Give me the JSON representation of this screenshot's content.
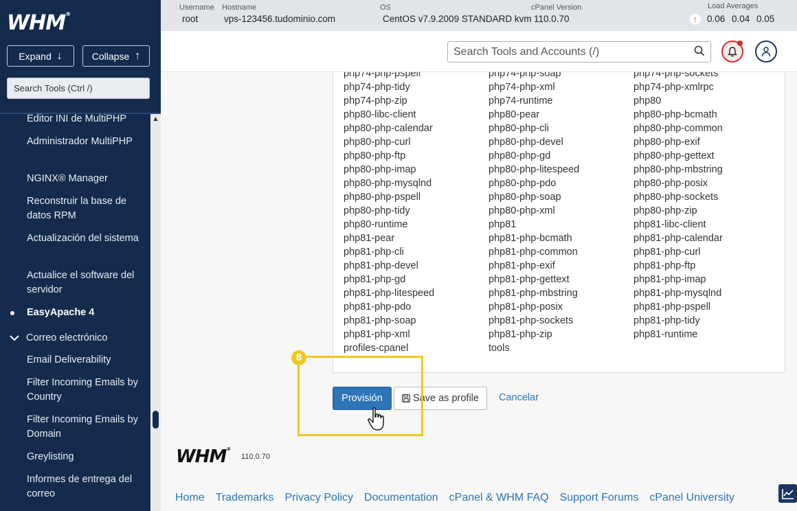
{
  "app": {
    "logo": "WHM",
    "version": "110.0.70"
  },
  "sidebar": {
    "expand_label": "Expand",
    "collapse_label": "Collapse",
    "search_placeholder": "Search Tools (Ctrl /)",
    "items": [
      "Editor INI de MultiPHP",
      "Administrador MultiPHP",
      "NGINX® Manager",
      "Reconstruir la base de datos RPM",
      "Actualización del sistema",
      "Actualice el software del servidor",
      "EasyApache 4",
      "Email Deliverability",
      "Filter Incoming Emails by Country",
      "Filter Incoming Emails by Domain",
      "Greylisting",
      "Informes de entrega del correo"
    ],
    "section_label": "Correo electrónico"
  },
  "topbar": {
    "username_label": "Username",
    "username": "root",
    "hostname_label": "Hostname",
    "hostname": "vps-123456.tudominio.com",
    "os_label": "OS",
    "os": "CentOS v7.9.2009 STANDARD kvm",
    "cpanel_label": "cPanel Version",
    "cpanel_version": "110.0.70",
    "load_label": "Load Averages",
    "load": [
      "0.06",
      "0.04",
      "0.05"
    ]
  },
  "header": {
    "search_placeholder": "Search Tools and Accounts (/)"
  },
  "packages": {
    "col1": [
      "php74-php-pspell",
      "php74-php-tidy",
      "php74-php-zip",
      "php80-libc-client",
      "php80-php-calendar",
      "php80-php-curl",
      "php80-php-ftp",
      "php80-php-imap",
      "php80-php-mysqlnd",
      "php80-php-pspell",
      "php80-php-tidy",
      "php80-runtime",
      "php81-pear",
      "php81-php-cli",
      "php81-php-devel",
      "php81-php-gd",
      "php81-php-litespeed",
      "php81-php-pdo",
      "php81-php-soap",
      "php81-php-xml",
      "profiles-cpanel"
    ],
    "col2": [
      "php74-php-soap",
      "php74-php-xml",
      "php74-runtime",
      "php80-pear",
      "php80-php-cli",
      "php80-php-devel",
      "php80-php-gd",
      "php80-php-litespeed",
      "php80-php-pdo",
      "php80-php-soap",
      "php80-php-xml",
      "php81",
      "php81-php-bcmath",
      "php81-php-common",
      "php81-php-exif",
      "php81-php-gettext",
      "php81-php-mbstring",
      "php81-php-posix",
      "php81-php-sockets",
      "php81-php-zip",
      "tools"
    ],
    "col3": [
      "php74-php-sockets",
      "php74-php-xmlrpc",
      "php80",
      "php80-php-bcmath",
      "php80-php-common",
      "php80-php-exif",
      "php80-php-gettext",
      "php80-php-mbstring",
      "php80-php-posix",
      "php80-php-sockets",
      "php80-php-zip",
      "php81-libc-client",
      "php81-php-calendar",
      "php81-php-curl",
      "php81-php-ftp",
      "php81-php-imap",
      "php81-php-mysqlnd",
      "php81-php-pspell",
      "php81-php-tidy",
      "php81-runtime"
    ]
  },
  "actions": {
    "provision_label": "Provisión",
    "save_profile_label": "Save as profile",
    "cancel_label": "Cancelar"
  },
  "annotation": {
    "step": "8",
    "color": "#f0c820"
  },
  "footer": {
    "logo": "WHM",
    "version": "110.0.70",
    "links": [
      "Home",
      "Trademarks",
      "Privacy Policy",
      "Documentation",
      "cPanel & WHM FAQ",
      "Support Forums",
      "cPanel University"
    ]
  },
  "colors": {
    "sidebar_bg": "#142b4d",
    "accent": "#2e74b6",
    "alert": "#d0302b"
  }
}
